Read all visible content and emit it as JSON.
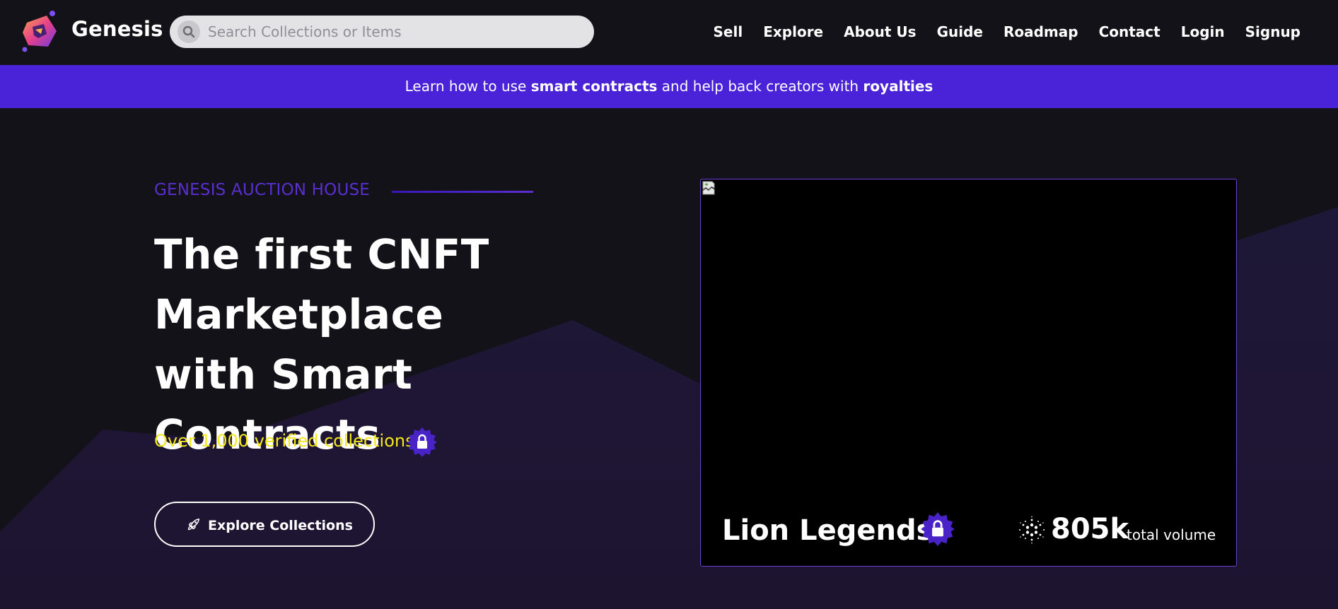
{
  "nav": {
    "brand": "Genesis",
    "search_placeholder": "Search Collections or Items",
    "links": [
      "Sell",
      "Explore",
      "About Us",
      "Guide",
      "Roadmap",
      "Contact",
      "Login",
      "Signup"
    ]
  },
  "banner": {
    "part1": "Learn how to use ",
    "bold1": "smart contracts",
    "part2": " and help back creators with ",
    "bold2": "royalties"
  },
  "hero": {
    "kicker": "GENESIS AUCTION HOUSE",
    "headline": "The first CNFT Marketplace with Smart Contracts",
    "verified_text": "Over 1,000 verified collections",
    "cta_label": "Explore Collections"
  },
  "featured": {
    "name": "Lion Legends",
    "volume": "805k",
    "volume_label": "total volume"
  },
  "colors": {
    "accent": "#4a23d8",
    "verified_yellow": "#f5e81a",
    "kicker_purple": "#5a2fd0",
    "background": "#131218"
  },
  "icons": [
    "genesis-logo",
    "search-icon",
    "lock-badge-icon",
    "rocket-icon",
    "cardano-icon",
    "broken-image-icon"
  ]
}
